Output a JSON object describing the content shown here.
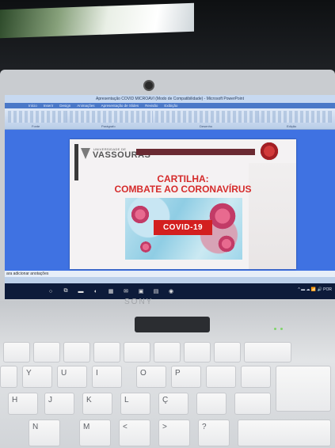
{
  "window": {
    "title": "Apresentação COVID MICROAVI (Modo de Compatibilidade) - Microsoft PowerPoint",
    "tabs": [
      "Início",
      "Inserir",
      "Design",
      "Animações",
      "Apresentação de Slides",
      "Revisão",
      "Exibição"
    ]
  },
  "ribbon_groups": [
    "Fonte",
    "Parágrafo",
    "Desenho",
    "Edição"
  ],
  "slide": {
    "logo_small": "Universidade de",
    "logo_big": "VASSOURAS",
    "title_line1": "CARTILHA:",
    "title_line2": "COMBATE AO CORONAVÍRUS",
    "badge": "COVID-19"
  },
  "notes_placeholder": "ara adicionar anotações",
  "taskbar": {
    "tray_text": "^ ▬ ☁ 📶 🔊 POR"
  },
  "laptop": {
    "brand": "SONY"
  },
  "keyboard": {
    "row1": [
      "Y",
      "U",
      "I",
      "O",
      "P"
    ],
    "row2": [
      "H",
      "J",
      "K",
      "L",
      "Ç"
    ],
    "row3": [
      "N",
      "M",
      "<",
      ">",
      "?"
    ]
  },
  "colors": {
    "slide_title": "#d52b2b",
    "badge_bg": "#d31f1f",
    "workspace_blue": "#3f72e2",
    "taskbar": "#0d1b3a"
  }
}
